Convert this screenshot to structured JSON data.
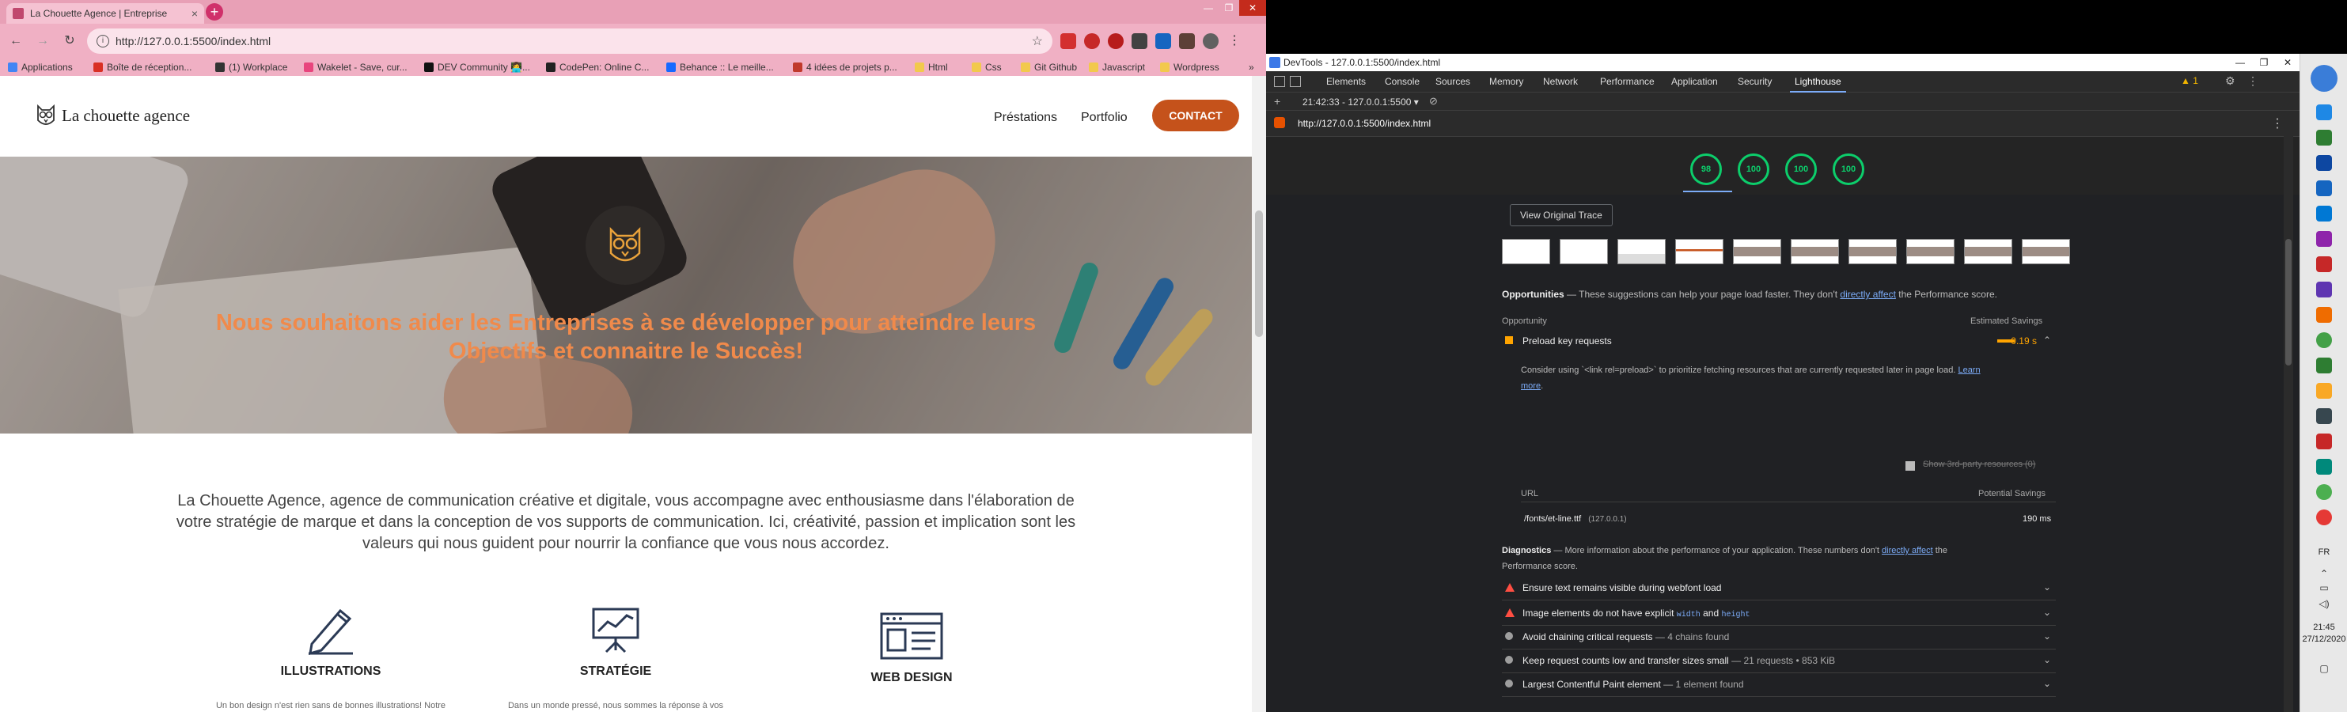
{
  "browser": {
    "tab_title": "La Chouette Agence | Entreprise",
    "tab_close": "×",
    "new_tab": "+",
    "url": "http://127.0.0.1:5500/index.html",
    "window_buttons": [
      "—",
      "❐",
      "✕"
    ],
    "bookmarks": [
      {
        "label": "Applications",
        "color": "#4285f4"
      },
      {
        "label": "Boîte de réception...",
        "color": "#d93025"
      },
      {
        "label": "(1) Workplace",
        "color": "#333333"
      },
      {
        "label": "Wakelet - Save, cur...",
        "color": "#e8457d"
      },
      {
        "label": "DEV Community 👩‍💻...",
        "color": "#111111"
      },
      {
        "label": "CodePen: Online C...",
        "color": "#222222"
      },
      {
        "label": "Behance :: Le meille...",
        "color": "#1769ff"
      },
      {
        "label": "4 idées de projets p...",
        "color": "#c0392b"
      },
      {
        "label": "Html",
        "color": "#f2c94c"
      },
      {
        "label": "Css",
        "color": "#f2c94c"
      },
      {
        "label": "Git Github",
        "color": "#f2c94c"
      },
      {
        "label": "Javascript",
        "color": "#f2c94c"
      },
      {
        "label": "Wordpress",
        "color": "#f2c94c"
      }
    ],
    "bookmarks_more": "»"
  },
  "site": {
    "logo_text": "La chouette agence",
    "nav": [
      "Préstations",
      "Portfolio"
    ],
    "contact": "CONTACT",
    "hero_headline_1": "Nous souhaitons aider les Entreprises à se développer pour atteindre leurs",
    "hero_headline_2": "Objectifs et connaitre le Succès!",
    "intro_1": "La Chouette Agence, agence de communication créative et digitale, vous accompagne avec enthousiasme dans l'élaboration de",
    "intro_2": "votre stratégie de marque et dans la conception de vos supports de communication. Ici, créativité, passion et implication sont les",
    "intro_3": "valeurs qui nous guident pour nourrir la confiance que vous nous accordez.",
    "services": [
      {
        "title": "ILLUSTRATIONS",
        "desc": "Un bon design n'est rien sans de bonnes illustrations! Notre"
      },
      {
        "title": "STRATÉGIE",
        "desc": "Dans un monde pressé, nous sommes la réponse à vos"
      },
      {
        "title": "WEB DESIGN",
        "desc": ""
      }
    ],
    "accent_color": "#c5521b",
    "headline_color": "#f08a4b"
  },
  "devtools": {
    "title": "DevTools - 127.0.0.1:5500/index.html",
    "tabs": [
      "Elements",
      "Console",
      "Sources",
      "Memory",
      "Network",
      "Performance",
      "Application",
      "Security",
      "Lighthouse"
    ],
    "active_tab": "Lighthouse",
    "warning_count": "1",
    "report_time": "21:42:33 - 127.0.0.1:5500 ▾",
    "report_url": "http://127.0.0.1:5500/index.html",
    "scores": [
      "98",
      "100",
      "100",
      "100"
    ],
    "view_trace": "View Original Trace",
    "opportunities_title": "Opportunities",
    "opportunities_text": " — These suggestions can help your page load faster. They don't ",
    "opportunities_link": "directly affect",
    "opportunities_tail": " the Performance score.",
    "col_opportunity": "Opportunity",
    "col_savings": "Estimated Savings",
    "preload_title": "Preload key requests",
    "preload_saving": "0.19 s",
    "preload_desc_1": "Consider using `<link rel=preload>` to prioritize fetching resources that are currently requested later in page load. ",
    "preload_link_1": "Learn",
    "preload_link_2": "more",
    "preload_link_tail": ".",
    "third_party": "Show 3rd-party resources (0)",
    "col_url": "URL",
    "col_potential": "Potential Savings",
    "resource_path": "/fonts/et-line.ttf",
    "resource_host": "(127.0.0.1)",
    "resource_saving": "190 ms",
    "diagnostics_title": "Diagnostics",
    "diagnostics_text": " — More information about the performance of your application. These numbers don't ",
    "diagnostics_link": "directly affect",
    "diagnostics_tail_1": " the",
    "diagnostics_tail_2": "Performance score.",
    "diag_items": [
      {
        "label": "Ensure text remains visible during webfont load",
        "sub": "",
        "marker": "tri"
      },
      {
        "label": "Image elements do not have explicit ",
        "code1": "width",
        "mid": " and ",
        "code2": "height",
        "marker": "tri"
      },
      {
        "label": "Avoid chaining critical requests",
        "sub": " — 4 chains found",
        "marker": "dot"
      },
      {
        "label": "Keep request counts low and transfer sizes small",
        "sub": " — 21 requests • 853 KiB",
        "marker": "dot"
      },
      {
        "label": "Largest Contentful Paint element",
        "sub": " — 1 element found",
        "marker": "dot"
      }
    ],
    "score_color": "#0cce6b"
  },
  "taskbar": {
    "lang": "FR",
    "time": "21:45",
    "date": "27/12/2020"
  }
}
